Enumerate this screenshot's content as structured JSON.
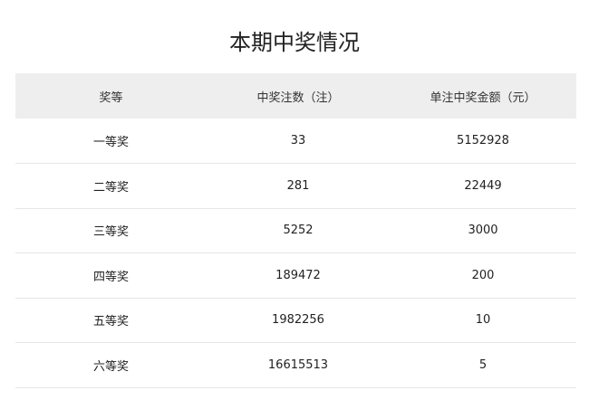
{
  "title": "本期中奖情况",
  "table": {
    "headers": [
      "奖等",
      "中奖注数（注）",
      "单注中奖金额（元）"
    ],
    "rows": [
      [
        "一等奖",
        "33",
        "5152928"
      ],
      [
        "二等奖",
        "281",
        "22449"
      ],
      [
        "三等奖",
        "5252",
        "3000"
      ],
      [
        "四等奖",
        "189472",
        "200"
      ],
      [
        "五等奖",
        "1982256",
        "10"
      ],
      [
        "六等奖",
        "16615513",
        "5"
      ]
    ]
  }
}
